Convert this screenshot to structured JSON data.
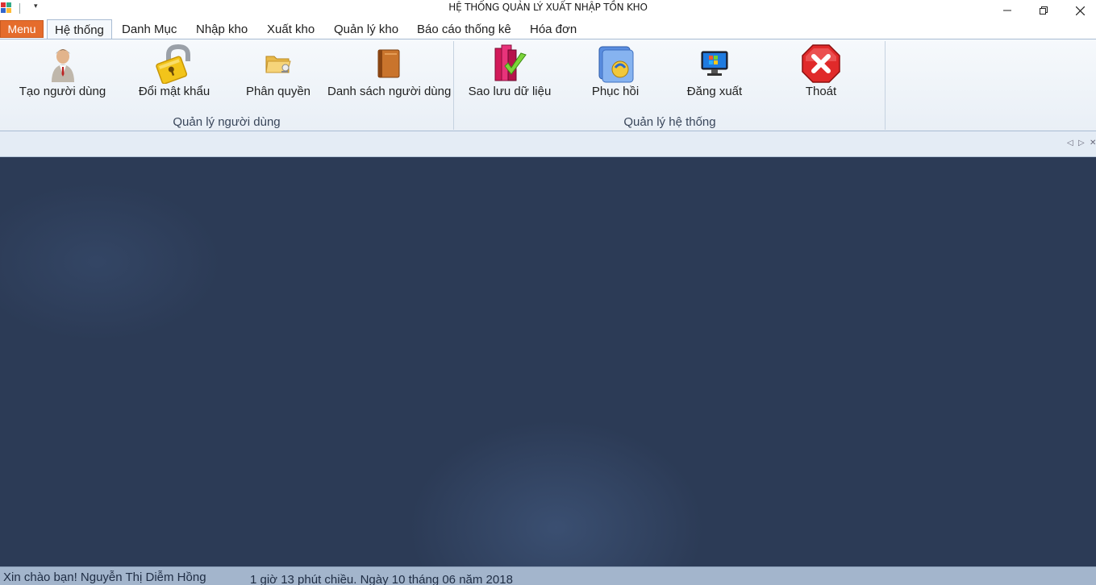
{
  "window": {
    "title": "HỆ THỐNG QUẢN LÝ XUẤT NHẬP TỒN KHO",
    "quick_access_dropdown": "▾",
    "controls": {
      "minimize": "minimize-icon",
      "restore": "restore-icon",
      "close": "close-icon"
    }
  },
  "ribbon_tabs": {
    "menu_label": "Menu",
    "tabs": [
      {
        "label": "Hệ thống",
        "active": true
      },
      {
        "label": "Danh Mục"
      },
      {
        "label": "Nhập kho"
      },
      {
        "label": "Xuất kho"
      },
      {
        "label": "Quản lý kho"
      },
      {
        "label": "Báo cáo thống kê"
      },
      {
        "label": "Hóa đơn"
      }
    ]
  },
  "ribbon": {
    "groups": [
      {
        "label": "Quản lý người dùng",
        "buttons": [
          {
            "label": "Tạo người dùng",
            "icon": "user-icon"
          },
          {
            "label": "Đổi mật khẩu",
            "icon": "padlock-icon"
          },
          {
            "label": "Phân quyền",
            "icon": "folder-key-icon"
          },
          {
            "label": "Danh sách người dùng",
            "icon": "book-icon"
          }
        ]
      },
      {
        "label": "Quản lý hệ thống",
        "buttons": [
          {
            "label": "Sao lưu dữ liệu",
            "icon": "backup-books-icon"
          },
          {
            "label": "Phục hồi",
            "icon": "restore-folder-icon"
          },
          {
            "label": "Đăng xuất",
            "icon": "monitor-icon"
          },
          {
            "label": "Thoát",
            "icon": "exit-x-icon"
          }
        ]
      }
    ]
  },
  "doc_strip": {
    "prev": "◁",
    "next": "▷",
    "close": "✕"
  },
  "status_bar": {
    "greeting": "Xin chào bạn! Nguyễn Thị Diễm Hồng",
    "datetime": "1 giờ 13 phút chiều. Ngày 10 tháng 06 năm 2018"
  },
  "colors": {
    "menu_button": "#e56c2c",
    "workspace": "#2c3b56",
    "status_bar": "#a3b5cc",
    "ribbon": "#eef3f9"
  }
}
